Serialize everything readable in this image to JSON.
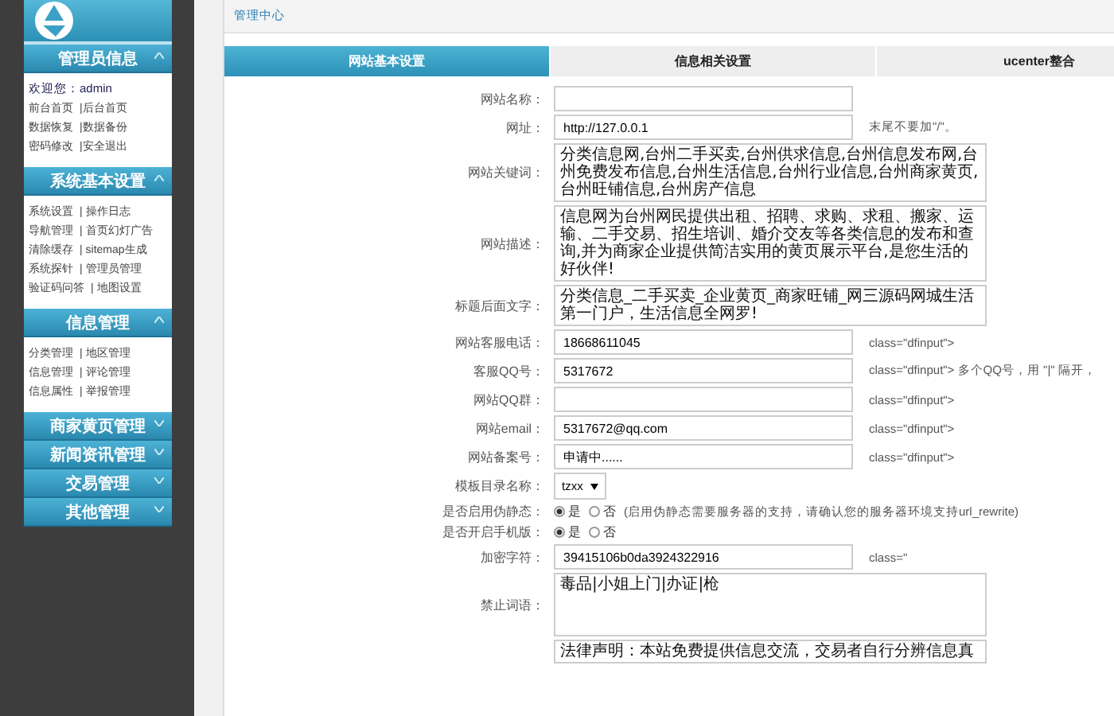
{
  "sidebar": {
    "groups": [
      {
        "title": "管理员信息",
        "expanded": true,
        "lines": [
          [
            "欢迎您：admin"
          ],
          [
            "前台首页",
            "|后台首页"
          ],
          [
            "数据恢复",
            "|数据备份"
          ],
          [
            "密码修改",
            "|安全退出"
          ]
        ]
      },
      {
        "title": "系统基本设置",
        "expanded": true,
        "lines": [
          [
            "系统设置",
            "| 操作日志"
          ],
          [
            "导航管理",
            "| 首页幻灯广告"
          ],
          [
            "清除缓存",
            "| sitemap生成"
          ],
          [
            "系统探针",
            "| 管理员管理"
          ],
          [
            "验证码问答",
            "| 地图设置"
          ]
        ]
      },
      {
        "title": "信息管理",
        "expanded": true,
        "lines": [
          [
            "分类管理",
            "| 地区管理"
          ],
          [
            "信息管理",
            "| 评论管理"
          ],
          [
            "信息属性",
            "| 举报管理"
          ]
        ]
      },
      {
        "title": "商家黄页管理",
        "expanded": false
      },
      {
        "title": "新闻资讯管理",
        "expanded": false
      },
      {
        "title": "交易管理",
        "expanded": false
      },
      {
        "title": "其他管理",
        "expanded": false
      }
    ]
  },
  "breadcrumb": "管理中心",
  "tabs": [
    {
      "label": "网站基本设置",
      "selected": true
    },
    {
      "label": "信息相关设置",
      "selected": false
    },
    {
      "label": "ucenter整合",
      "selected": false
    }
  ],
  "fields": [
    {
      "kind": "text",
      "label": "网站名称："
    },
    {
      "kind": "text",
      "label": "网址：",
      "value": "http://127.0.0.1",
      "hint": "末尾不要加\"/\"。"
    },
    {
      "kind": "textarea",
      "label": "网站关键词：",
      "value": "分类信息网,台州二手买卖,台州供求信息,台州信息发布网,台州免费发布信息,台州生活信息,台州行业信息,台州商家黄页,台州旺铺信息,台州房产信息"
    },
    {
      "kind": "textarea",
      "label": "网站描述：",
      "value": "信息网为台州网民提供出租、招聘、求购、求租、搬家、运输、二手交易、招生培训、婚介交友等各类信息的发布和查询,并为商家企业提供简洁实用的黄页展示平台,是您生活的好伙伴!"
    },
    {
      "kind": "textarea",
      "label": "标题后面文字：",
      "value": "分类信息_二手买卖_企业黄页_商家旺铺_网三源码网城生活第一门户，生活信息全网罗!"
    },
    {
      "kind": "text",
      "label": "网站客服电话：",
      "value": "18668611045",
      "hint": "class=\"dfinput\">"
    },
    {
      "kind": "text",
      "label": "客服QQ号：",
      "value": "5317672",
      "hint": "class=\"dfinput\"> 多个QQ号，用 \"|\" 隔开，"
    },
    {
      "kind": "text",
      "label": "网站QQ群：",
      "hint": "class=\"dfinput\">"
    },
    {
      "kind": "text",
      "label": "网站email：",
      "value": "5317672@qq.com",
      "hint": "class=\"dfinput\">"
    },
    {
      "kind": "text",
      "label": "网站备案号：",
      "value": "申请中......",
      "hint": "class=\"dfinput\">"
    },
    {
      "kind": "select",
      "label": "模板目录名称：",
      "value": "tzxx"
    },
    {
      "kind": "radio",
      "label": "是否启用伪静态：",
      "options": [
        {
          "label": "是",
          "selected": true
        },
        {
          "label": "否",
          "selected": false
        }
      ],
      "note": "(启用伪静态需要服务器的支持，请确认您的服务器环境支持url_rewrite)"
    },
    {
      "kind": "radio",
      "label": "是否开启手机版：",
      "options": [
        {
          "label": "是",
          "selected": true
        },
        {
          "label": "否",
          "selected": false
        }
      ]
    },
    {
      "kind": "text",
      "label": "加密字符：",
      "value": "39415106b0da3924322916",
      "hint": "class=\""
    },
    {
      "kind": "textarea",
      "label": "禁止词语：",
      "value": "毒品|小姐上门|办证|枪"
    },
    {
      "kind": "textarea",
      "value": "法律声明：本站免费提供信息交流，交易者自行分辨信息真"
    }
  ]
}
